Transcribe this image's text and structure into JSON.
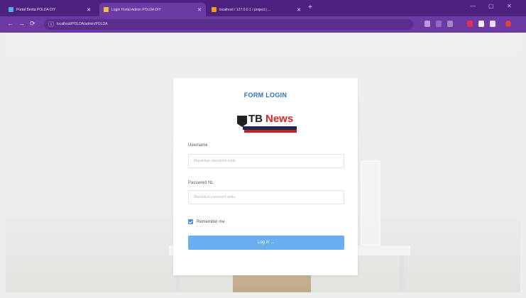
{
  "browser": {
    "tabs": [
      {
        "label": "Portal Berita POLDA DIY",
        "favicon_color": "#4fb0e6"
      },
      {
        "label": "Login Portal Admin POLDA DIY",
        "favicon_color": "#f0c040"
      },
      {
        "label": "localhost / 127.0.0.1 / project | ...",
        "favicon_color": "#f0a000"
      }
    ],
    "new_tab": "+",
    "url": "localhost/POLDA/admin/POLDA"
  },
  "login": {
    "title": "FORM LOGIN",
    "logo": {
      "tb": "TB",
      "news": "News"
    },
    "username_label": "Username",
    "username_placeholder": "Masukkan username anda",
    "password_label": "Password NL",
    "password_placeholder": "Masukkan password anda",
    "remember_label": "Remember me",
    "remember_checked": true,
    "submit_label": "Log in →"
  },
  "colors": {
    "browser_frame": "#4d2180",
    "title": "#2c6cc4",
    "button": "#6aaef0",
    "checkbox": "#4e8fd8"
  }
}
